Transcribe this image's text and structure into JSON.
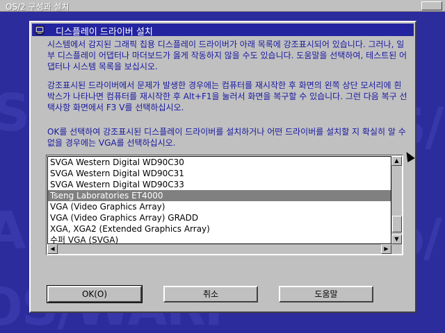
{
  "window": {
    "title": "OS/2 구성과 설치"
  },
  "dialog": {
    "title": "디스플레이 드라이버 설치",
    "para1": "시스템에서 감지된 그래픽 칩용 디스플레이 드라이버가 아래 목록에 강조표시되어 있습니다. 그러나, 일부 디스플레이 어댑터나 마더보드가 옳게 작동하지 않을 수도 있습니다. 도움말을 선택하여, 테스트된 어댑터나 시스템 목록을 보십시오.",
    "para2": "강조표시된 드라이버에서 문제가 발생한 경우에는 컴퓨터를 재시작한 후 화면의 왼쪽 상단 모서리에 흰 박스가 나타나면 컴퓨터를 재시작한 후 Alt+F1을 눌러서 화면을 복구할 수 있습니다. 그런 다음 복구 선택사항 화면에서 F3 V를 선택하십시오.",
    "para3": "OK를 선택하여 강조표시된 디스플레이 드라이버를 설치하거나 어떤 드라이버를 설치할 지 확실히 알 수 없을 경우에는 VGA를 선택하십시오."
  },
  "list": {
    "items": [
      "SVGA Western Digital WD90C30",
      "SVGA Western Digital WD90C31",
      "SVGA Western Digital WD90C33",
      "Tseng Laboratories ET4000",
      "VGA (Video Graphics Array)",
      "VGA (Video Graphics Array) GRADD",
      "XGA, XGA2 (Extended Graphics Array)",
      "수퍼 VGA (SVGA)"
    ],
    "selected": "Tseng Laboratories ET4000"
  },
  "buttons": {
    "ok": "OK(O)",
    "cancel": "취소",
    "help": "도움말"
  },
  "colors": {
    "desktop": "#2c2c9c",
    "titlebar": "#2424a0",
    "text": "#1818a0",
    "selection": "#808080"
  }
}
